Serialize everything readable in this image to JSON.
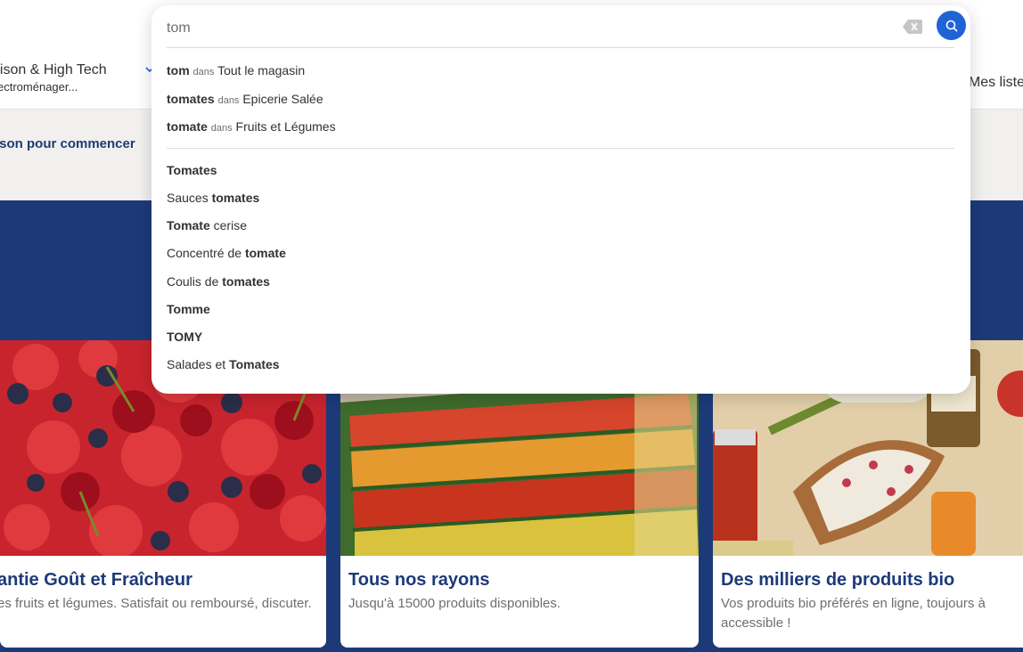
{
  "nav": {
    "category_title": "aison & High Tech",
    "category_sub": "ectroménager...",
    "chevron": "chevron-down-icon",
    "my_lists": "Mes liste"
  },
  "delivery": {
    "prompt": "ison pour commencer"
  },
  "search": {
    "value": "tom",
    "clear_icon": "backspace-clear-icon",
    "search_icon": "search-icon",
    "accent": "#1f64d6",
    "scoped": [
      {
        "term": "tom",
        "dans": "dans",
        "scope": "Tout le magasin"
      },
      {
        "term": "tomates",
        "dans": "dans",
        "scope": "Epicerie Salée"
      },
      {
        "term": "tomate",
        "dans": "dans",
        "scope": "Fruits et Légumes"
      }
    ],
    "terms": [
      {
        "pre": "",
        "bold": "Tomates",
        "post": ""
      },
      {
        "pre": "Sauces ",
        "bold": "tomates",
        "post": ""
      },
      {
        "pre": "",
        "bold": "Tomate",
        "post": " cerise"
      },
      {
        "pre": "Concentré de ",
        "bold": "tomate",
        "post": ""
      },
      {
        "pre": "Coulis de ",
        "bold": "tomates",
        "post": ""
      },
      {
        "pre": "",
        "bold": "Tomme",
        "post": ""
      },
      {
        "pre": "",
        "bold": "TOMY",
        "post": ""
      },
      {
        "pre": "Salades et ",
        "bold": "Tomates",
        "post": ""
      }
    ]
  },
  "cards": [
    {
      "title": "antie Goût et Fraîcheur",
      "desc": "es fruits et légumes. Satisfait ou remboursé, discuter."
    },
    {
      "title": "Tous nos rayons",
      "desc": "Jusqu'à 15000 produits disponibles."
    },
    {
      "title": "Des milliers de produits bio",
      "desc": "Vos produits bio préférés en ligne, toujours à accessible !"
    }
  ],
  "colors": {
    "brand_navy": "#1d3a78",
    "title_blue": "#1f3b73"
  }
}
